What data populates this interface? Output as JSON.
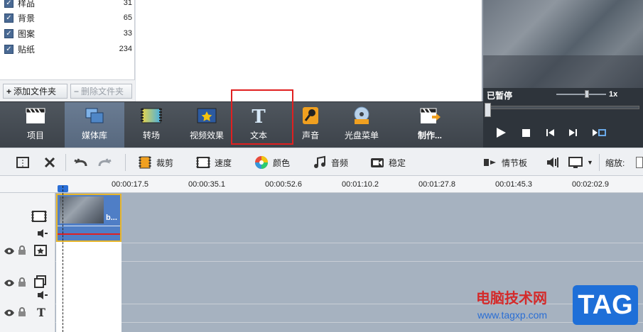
{
  "library": {
    "categories": [
      {
        "name": "样品",
        "count": "31"
      },
      {
        "name": "背景",
        "count": "65"
      },
      {
        "name": "图案",
        "count": "33"
      },
      {
        "name": "贴纸",
        "count": "234"
      }
    ],
    "add_folder": "添加文件夹",
    "remove_folder": "删除文件夹"
  },
  "preview": {
    "status": "已暂停",
    "speed": "1x"
  },
  "toolbar": {
    "items": [
      {
        "label": "项目",
        "icon": "clapper-icon"
      },
      {
        "label": "媒体库",
        "icon": "media-library-icon"
      },
      {
        "label": "转场",
        "icon": "transition-icon"
      },
      {
        "label": "视频效果",
        "icon": "video-effect-icon"
      },
      {
        "label": "文本",
        "icon": "text-icon"
      },
      {
        "label": "声音",
        "icon": "microphone-icon"
      },
      {
        "label": "光盘菜单",
        "icon": "disc-menu-icon"
      },
      {
        "label": "制作...",
        "icon": "produce-icon"
      }
    ]
  },
  "editbar": {
    "crop": "裁剪",
    "speed": "速度",
    "color": "颜色",
    "audio": "音频",
    "stabilize": "稳定",
    "storyboard": "情节板",
    "zoom": "缩放:"
  },
  "timeline": {
    "ticks": [
      "00:00:17.5",
      "00:00:35.1",
      "00:00:52.6",
      "00:01:10.2",
      "00:01:27.8",
      "00:01:45.3",
      "00:02:02.9"
    ],
    "clip_label": "b..."
  },
  "watermark": {
    "cn": "电脑技术网",
    "url": "www.tagxp.com",
    "logo": "TAG"
  },
  "colors": {
    "accent": "#4f7ec6",
    "highlight": "#e02020",
    "toolbar": "#454c54"
  }
}
